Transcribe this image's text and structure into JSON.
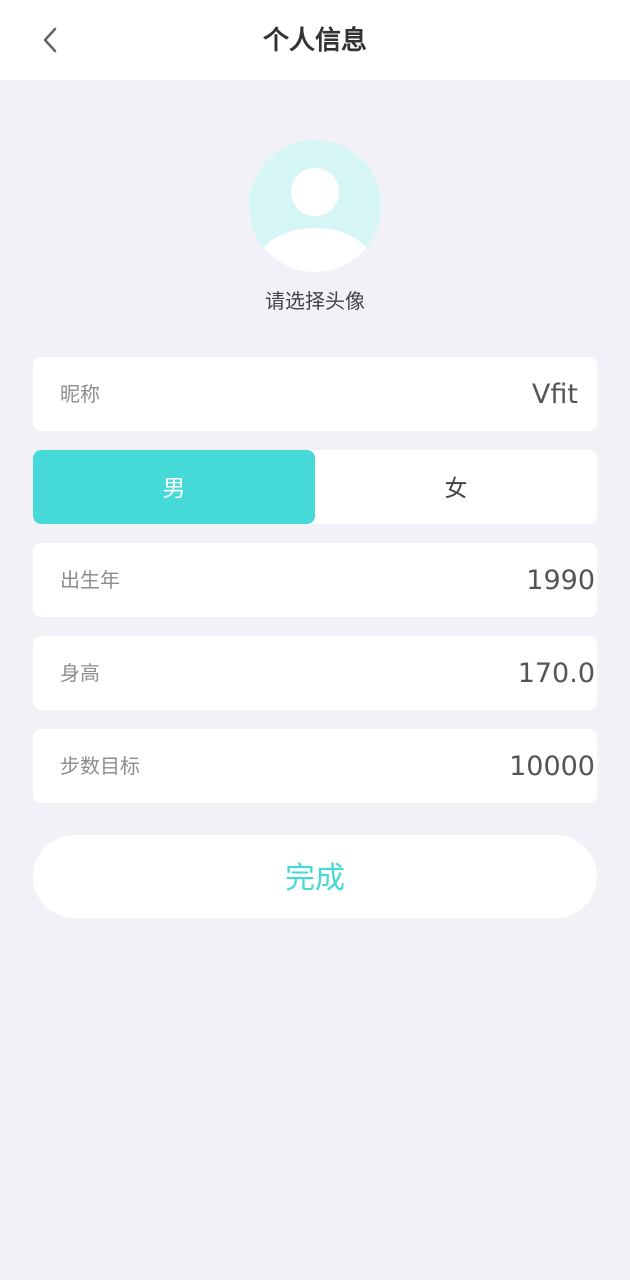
{
  "header": {
    "title": "个人信息",
    "back_icon": "chevron-left-icon"
  },
  "avatar": {
    "icon": "user-avatar-icon",
    "hint": "请选择头像",
    "bg_color": "#d6f6f5"
  },
  "form": {
    "nickname": {
      "label": "昵称",
      "value": "Vfit"
    },
    "gender": {
      "options": [
        "男",
        "女"
      ],
      "selected": "男",
      "active_color": "#45d9d8"
    },
    "birth_year": {
      "label": "出生年",
      "value": "1990"
    },
    "height": {
      "label": "身高",
      "value": "170.0"
    },
    "step_goal": {
      "label": "步数目标",
      "value": "10000"
    }
  },
  "actions": {
    "done_label": "完成",
    "done_color": "#45d9d8"
  }
}
